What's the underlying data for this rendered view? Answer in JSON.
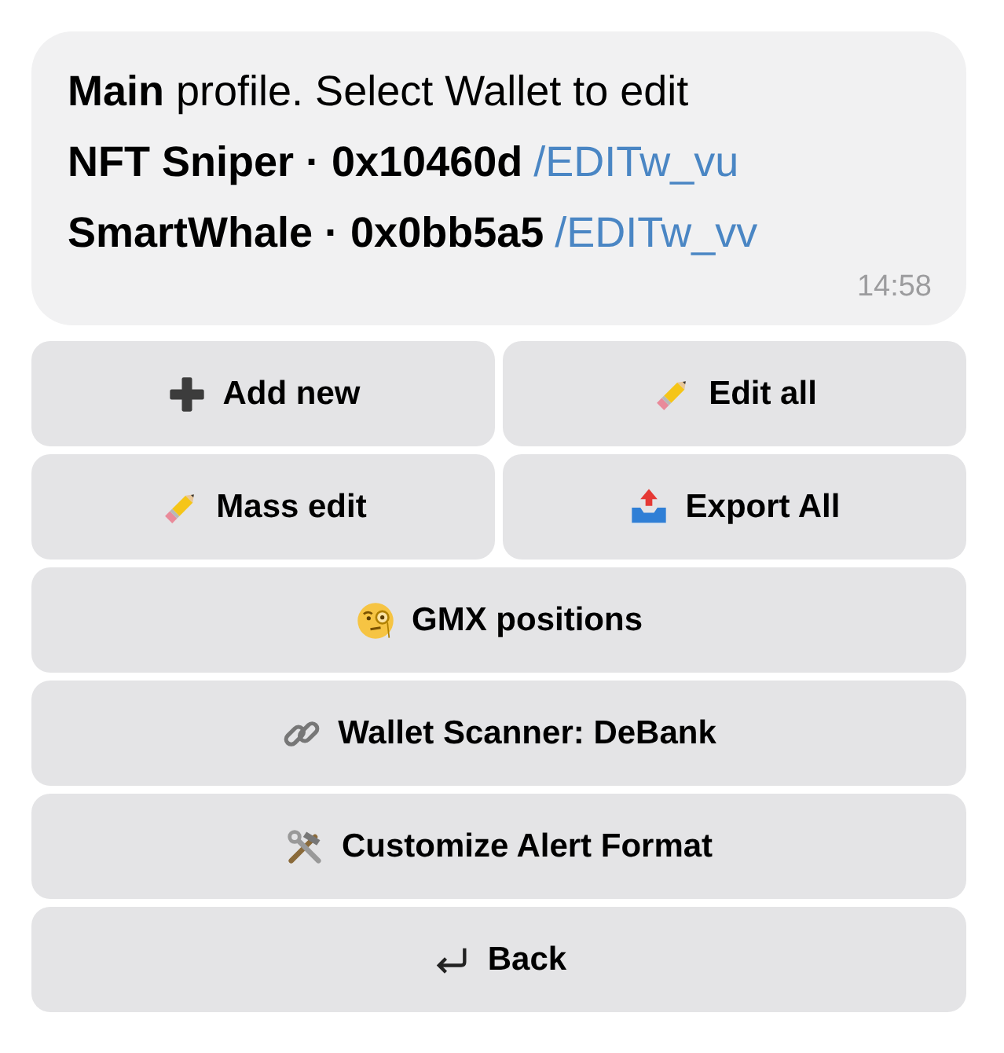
{
  "message": {
    "intro": "**Main** profile. Select Wallet to edit",
    "wallets": [
      {
        "label": "NFT Sniper · 0x10460d",
        "command": "/EDITw_vu"
      },
      {
        "label": "SmartWhale · 0x0bb5a5",
        "command": "/EDITw_vv"
      }
    ],
    "time": "14:58"
  },
  "keyboard": [
    [
      {
        "label": "Add new",
        "kind": "plus"
      },
      {
        "label": "Edit all",
        "kind": "pencil"
      }
    ],
    [
      {
        "label": "Mass edit",
        "kind": "pencil"
      },
      {
        "label": "Export All",
        "kind": "outbox"
      }
    ],
    [
      {
        "label": "GMX positions",
        "kind": "monocle"
      }
    ],
    [
      {
        "label": "Wallet Scanner: DeBank",
        "kind": "link"
      }
    ],
    [
      {
        "label": "Customize Alert Format",
        "kind": "tools"
      }
    ],
    [
      {
        "label": "Back",
        "kind": "return"
      }
    ]
  ]
}
